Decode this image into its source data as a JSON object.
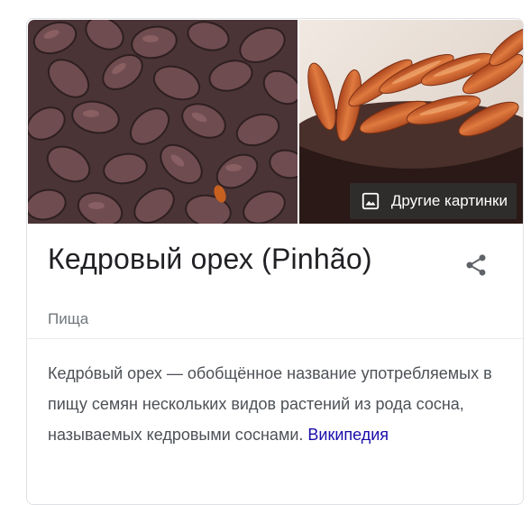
{
  "knowledge_panel": {
    "more_images_label": "Другие картинки",
    "more_images_icon": "image-icon",
    "share_icon": "share-icon",
    "title": "Кедровый орех (Pinhão)",
    "subtitle": "Пища",
    "description": "Кедро́вый орех — обобщённое название употребляемых в пищу семян нескольких видов растений из рода сосна, называемых кедровыми соснами. ",
    "source_link": "Википедия"
  },
  "colors": {
    "title": "#202124",
    "subtitle": "#70757a",
    "body_text": "#4d5156",
    "link": "#1a0dab",
    "overlay": "#303030"
  }
}
